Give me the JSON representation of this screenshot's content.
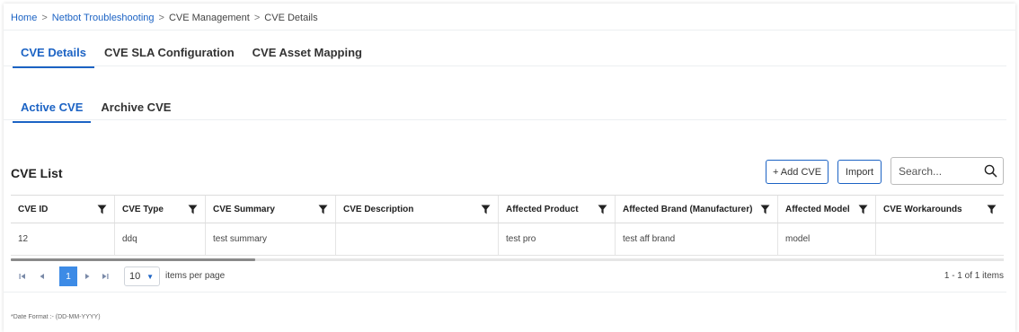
{
  "breadcrumb": {
    "items": [
      "Home",
      "Netbot Troubleshooting",
      "CVE Management",
      "CVE Details"
    ],
    "separator": ">"
  },
  "top_tabs": [
    "CVE Details",
    "CVE SLA Configuration",
    "CVE Asset Mapping"
  ],
  "sub_tabs": [
    "Active CVE",
    "Archive CVE"
  ],
  "list": {
    "title": "CVE List",
    "add_button": "+ Add CVE",
    "import_button": "Import",
    "search_placeholder": "Search..."
  },
  "table": {
    "columns": [
      "CVE ID",
      "CVE Type",
      "CVE Summary",
      "CVE Description",
      "Affected Product",
      "Affected Brand (Manufacturer)",
      "Affected Model",
      "CVE Workarounds"
    ],
    "rows": [
      [
        "12",
        "ddq",
        "test summary",
        "",
        "test pro",
        "test aff brand",
        "model",
        ""
      ]
    ]
  },
  "pager": {
    "current_page": "1",
    "page_size": "10",
    "items_per_page_label": "items per page",
    "info": "1 - 1 of 1 items"
  },
  "footer": {
    "date_format": "*Date Format :- (DD-MM-YYYY)"
  },
  "colors": {
    "accent": "#1c63c4",
    "page_active": "#3d8be6"
  },
  "icons": {
    "filter": "filter-icon",
    "search": "search-icon",
    "first_page": "first-page-icon",
    "prev_page": "prev-page-icon",
    "next_page": "next-page-icon",
    "last_page": "last-page-icon"
  }
}
